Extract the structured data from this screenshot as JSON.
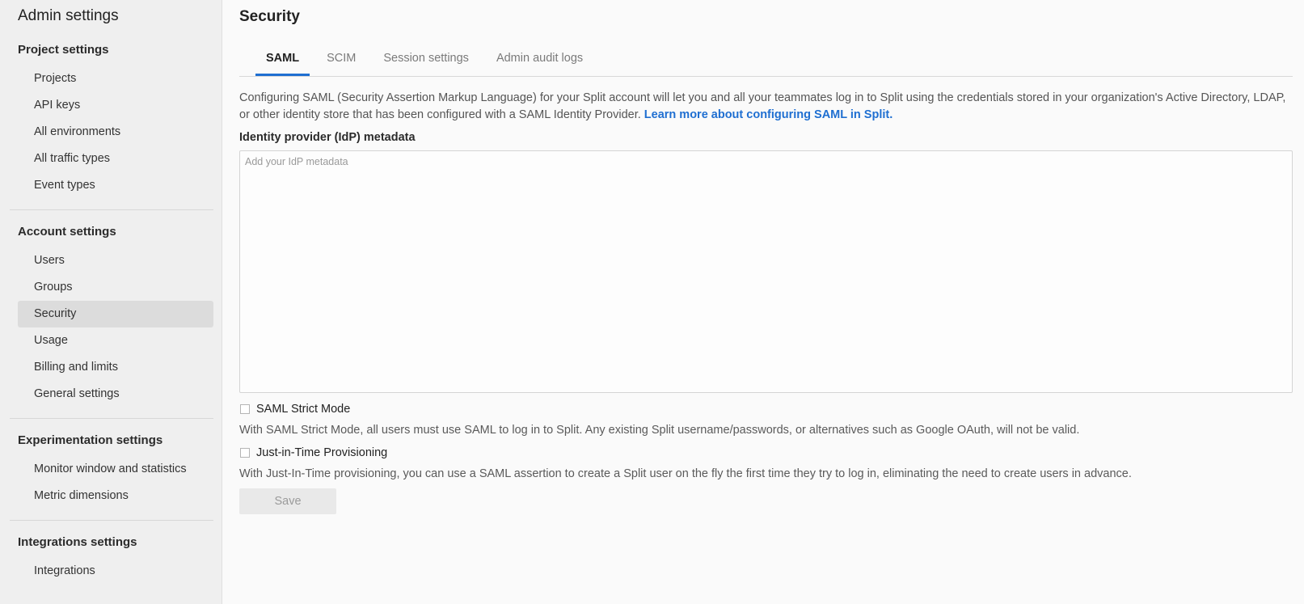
{
  "sidebar": {
    "title": "Admin settings",
    "groups": [
      {
        "title": "Project settings",
        "items": [
          "Projects",
          "API keys",
          "All environments",
          "All traffic types",
          "Event types"
        ]
      },
      {
        "title": "Account settings",
        "items": [
          "Users",
          "Groups",
          "Security",
          "Usage",
          "Billing and limits",
          "General settings"
        ]
      },
      {
        "title": "Experimentation settings",
        "items": [
          "Monitor window and statistics",
          "Metric dimensions"
        ]
      },
      {
        "title": "Integrations settings",
        "items": [
          "Integrations"
        ]
      }
    ],
    "active_item": "Security"
  },
  "main": {
    "title": "Security",
    "tabs": [
      {
        "label": "SAML",
        "active": true
      },
      {
        "label": "SCIM",
        "active": false
      },
      {
        "label": "Session settings",
        "active": false
      },
      {
        "label": "Admin audit logs",
        "active": false
      }
    ],
    "description": "Configuring SAML (Security Assertion Markup Language) for your Split account will let you and all your teammates log in to Split using the credentials stored in your organization's Active Directory, LDAP, or other identity store that has been configured with a SAML Identity Provider.",
    "learn_more_link": "Learn more about configuring SAML in Split.",
    "metadata_label": "Identity provider (IdP) metadata",
    "metadata_placeholder": "Add your IdP metadata",
    "metadata_value": "",
    "strict_mode": {
      "label": "SAML Strict Mode",
      "checked": false,
      "helper": "With SAML Strict Mode, all users must use SAML to log in to Split. Any existing Split username/passwords, or alternatives such as Google OAuth, will not be valid."
    },
    "jit": {
      "label": "Just-in-Time Provisioning",
      "checked": false,
      "helper": "With Just-In-Time provisioning, you can use a SAML assertion to create a Split user on the fly the first time they try to log in, eliminating the need to create users in advance."
    },
    "save_label": "Save"
  },
  "colors": {
    "accent": "#1f6fd1",
    "sidebar_bg": "#efefef",
    "active_item_bg": "#dcdcdc"
  }
}
